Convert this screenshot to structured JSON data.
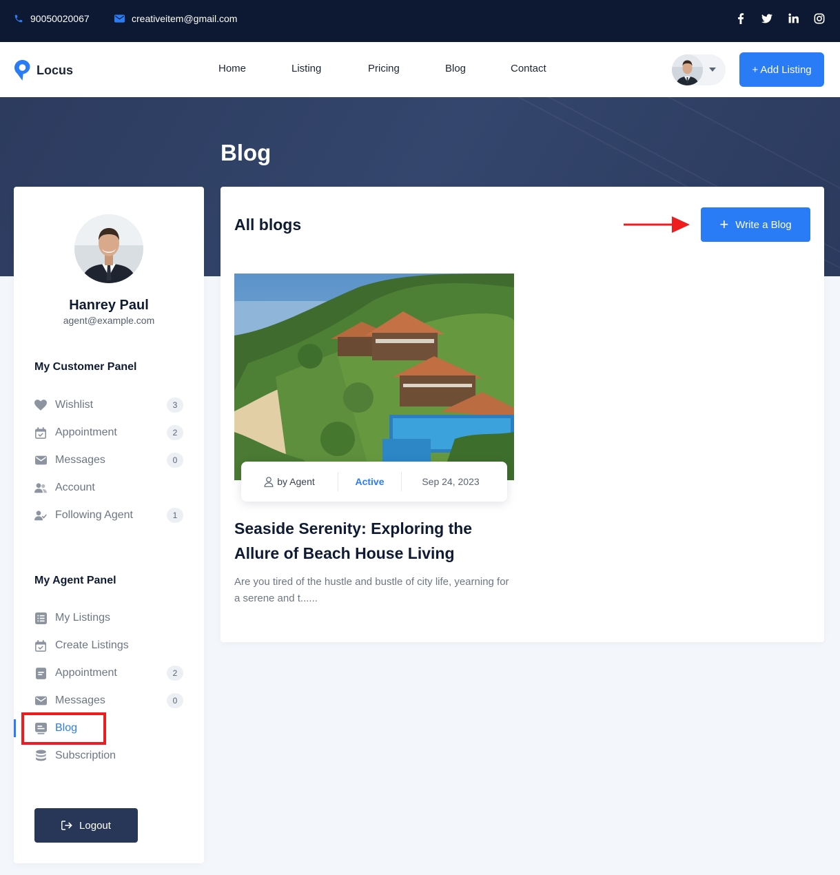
{
  "topbar": {
    "phone": "90050020067",
    "email": "creativeitem@gmail.com",
    "social": [
      "facebook-icon",
      "twitter-icon",
      "linkedin-icon",
      "instagram-icon"
    ]
  },
  "nav": {
    "logo": "Locus",
    "links": [
      "Home",
      "Listing",
      "Pricing",
      "Blog",
      "Contact"
    ],
    "add_listing": "+ Add Listing"
  },
  "hero": {
    "title": "Blog"
  },
  "profile": {
    "name": "Hanrey Paul",
    "email": "agent@example.com"
  },
  "customer_panel": {
    "title": "My Customer Panel",
    "items": [
      {
        "label": "Wishlist",
        "badge": "3",
        "icon": "heart-icon"
      },
      {
        "label": "Appointment",
        "badge": "2",
        "icon": "calendar-icon"
      },
      {
        "label": "Messages",
        "badge": "0",
        "icon": "envelope-icon"
      },
      {
        "label": "Account",
        "badge": "",
        "icon": "users-icon"
      },
      {
        "label": "Following Agent",
        "badge": "1",
        "icon": "user-check-icon"
      }
    ]
  },
  "agent_panel": {
    "title": "My Agent Panel",
    "items": [
      {
        "label": "My Listings",
        "badge": "",
        "icon": "list-icon"
      },
      {
        "label": "Create Listings",
        "badge": "",
        "icon": "calendar-check-icon"
      },
      {
        "label": "Appointment",
        "badge": "2",
        "icon": "document-icon"
      },
      {
        "label": "Messages",
        "badge": "0",
        "icon": "envelope-icon"
      },
      {
        "label": "Blog",
        "badge": "",
        "icon": "blog-icon"
      },
      {
        "label": "Subscription",
        "badge": "",
        "icon": "database-icon"
      }
    ]
  },
  "logout": "Logout",
  "content": {
    "title": "All blogs",
    "write_button": "Write a Blog"
  },
  "blog": {
    "author": "by Agent",
    "status": "Active",
    "date": "Sep 24, 2023",
    "title": "Seaside Serenity: Exploring the Allure of Beach House Living",
    "excerpt": "Are you tired of the hustle and bustle of city life, yearning for a serene and t......"
  },
  "colors": {
    "topbar": "#0d1832",
    "accent": "#2a7cf6",
    "hero": "#2f3f63",
    "logout": "#283758",
    "annotation": "#ee1c1c"
  }
}
